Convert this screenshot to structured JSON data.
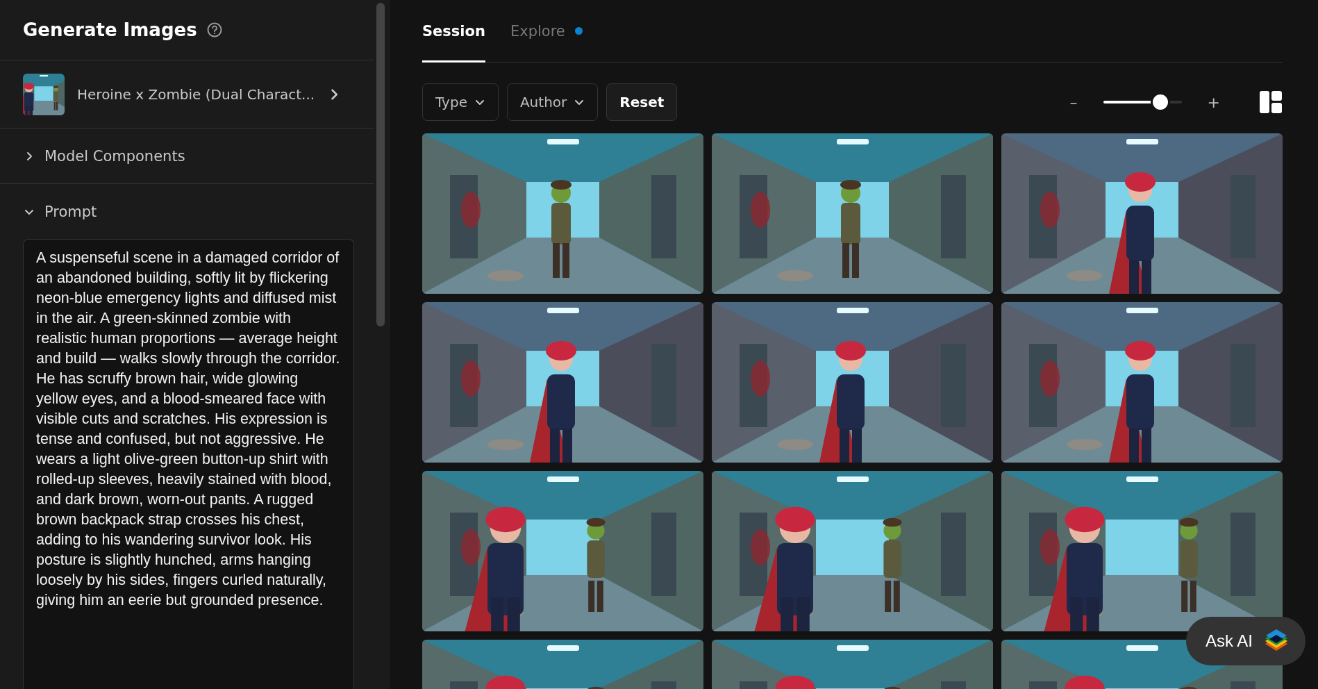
{
  "sidebar": {
    "title": "Generate Images",
    "model": {
      "name": "Heroine x Zombie (Dual Charact..."
    },
    "sections": [
      {
        "label": "Model Components",
        "expanded": false
      },
      {
        "label": "Prompt",
        "expanded": true
      }
    ],
    "prompt": "A suspenseful scene in a damaged corridor of an abandoned building, softly lit by flickering neon-blue emergency lights and diffused mist in the air. A green-skinned zombie with realistic human proportions — average height and build — walks slowly through the corridor. He has scruffy brown hair, wide glowing yellow eyes, and a blood-smeared face with visible cuts and scratches. His expression is tense and confused, but not aggressive. He wears a light olive-green button-up shirt with rolled-up sleeves, heavily stained with blood, and dark brown, worn-out pants. A rugged brown backpack strap crosses his chest, adding to his wandering survivor look. His posture is slightly hunched, arms hanging loosely by his sides, fingers curled naturally, giving him an eerie but grounded presence."
  },
  "tabs": [
    {
      "label": "Session",
      "selected": true,
      "has_update": false
    },
    {
      "label": "Explore",
      "selected": false,
      "has_update": true
    }
  ],
  "filters": [
    {
      "label": "Type",
      "kind": "dropdown"
    },
    {
      "label": "Author",
      "kind": "dropdown"
    },
    {
      "label": "Reset",
      "kind": "button"
    }
  ],
  "zoom": {
    "minus": "–",
    "plus": "+",
    "level": 0.73
  },
  "ask_ai": {
    "label": "Ask AI"
  }
}
